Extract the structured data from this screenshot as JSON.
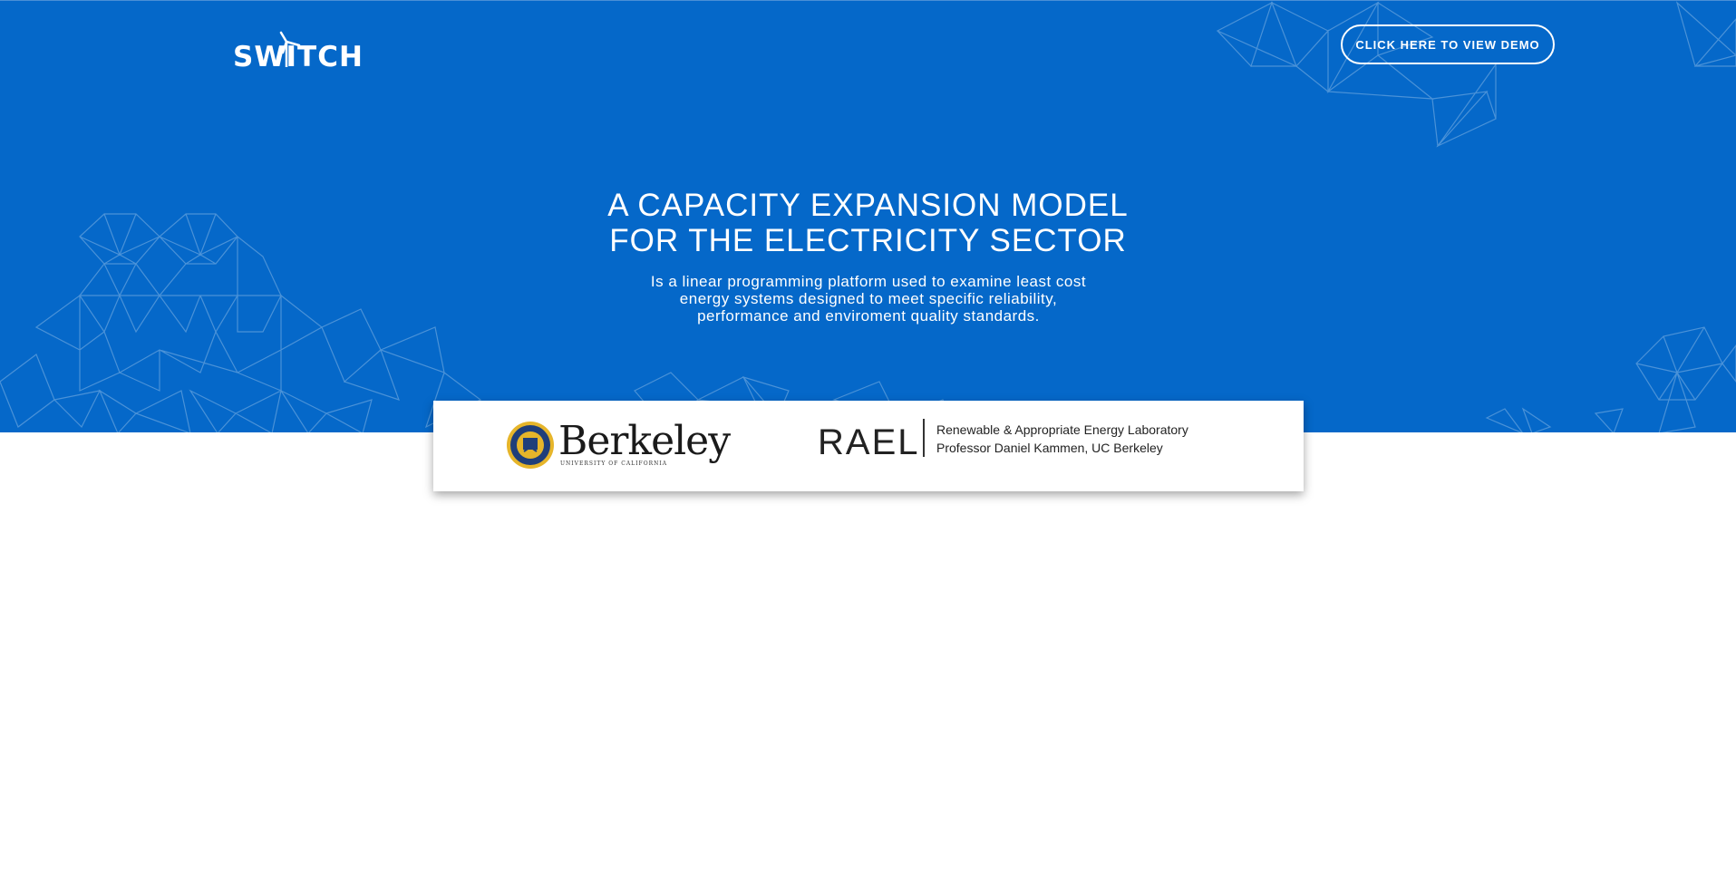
{
  "header": {
    "logo_text": "SWITCH",
    "demo_button_label": "CLICK HERE TO VIEW DEMO"
  },
  "hero": {
    "title_line1": "A CAPACITY EXPANSION MODEL",
    "title_line2": "FOR THE ELECTRICITY SECTOR",
    "desc_line1": "Is a linear programming platform used to examine least cost",
    "desc_line2": "energy systems designed to meet specific reliability,",
    "desc_line3": "performance and enviroment quality standards.",
    "background_color": "#0568c9"
  },
  "partners": {
    "berkeley": {
      "name": "Berkeley",
      "subtitle": "UNIVERSITY OF CALIFORNIA",
      "seal_icon": "uc-seal-icon"
    },
    "rael": {
      "name": "RAEL",
      "line1": "Renewable & Appropriate Energy Laboratory",
      "line2": "Professor Daniel Kammen, UC Berkeley"
    }
  }
}
